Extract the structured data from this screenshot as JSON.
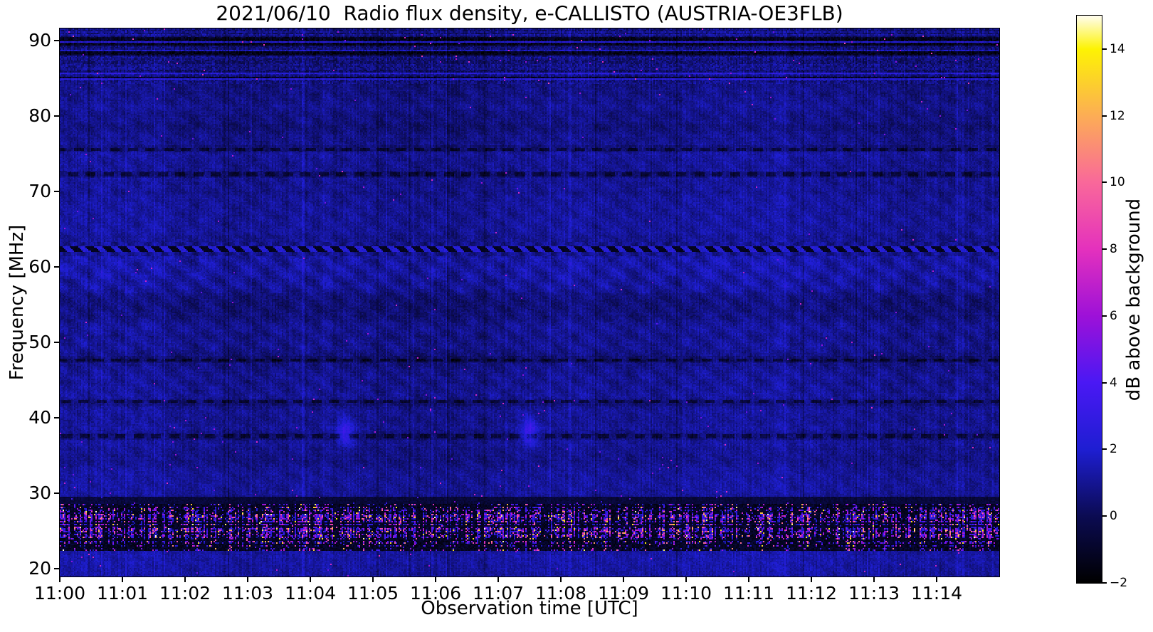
{
  "title": "2021/06/10  Radio flux density, e-CALLISTO (AUSTRIA-OE3FLB)",
  "chart_data": {
    "type": "heatmap",
    "subtype": "radio-spectrogram",
    "title": "2021/06/10  Radio flux density, e-CALLISTO (AUSTRIA-OE3FLB)",
    "xlabel": "Observation time [UTC]",
    "ylabel": "Frequency [MHz]",
    "colorbar_label": "dB above background",
    "x_ticks": [
      "11:00",
      "11:01",
      "11:02",
      "11:03",
      "11:04",
      "11:05",
      "11:06",
      "11:07",
      "11:08",
      "11:09",
      "11:10",
      "11:11",
      "11:12",
      "11:13",
      "11:14"
    ],
    "x_range_minutes": [
      0,
      15
    ],
    "y_ticks": [
      90,
      80,
      70,
      60,
      50,
      40,
      30,
      20
    ],
    "y_range_mhz": [
      19.0,
      91.6
    ],
    "colorbar_tick_values": [
      14,
      12,
      10,
      8,
      6,
      4,
      2,
      0,
      -2
    ],
    "colorbar_tick_labels": [
      "14",
      "12",
      "10",
      "8",
      "6",
      "4",
      "2",
      "0",
      "−2"
    ],
    "colorbar_range": [
      -2,
      15
    ],
    "grid": false,
    "legend": "none",
    "colormap": {
      "name": "gnuplot2-like",
      "stops": [
        [
          -2,
          "#000000"
        ],
        [
          0,
          "#0b0b52"
        ],
        [
          2,
          "#1e1ed2"
        ],
        [
          4,
          "#4a18f4"
        ],
        [
          6,
          "#9d11d8"
        ],
        [
          8,
          "#e431bd"
        ],
        [
          10,
          "#f9689a"
        ],
        [
          12,
          "#fcad55"
        ],
        [
          14,
          "#fdf303"
        ],
        [
          15,
          "#fffdf0"
        ]
      ]
    },
    "seed": 42,
    "bands": [
      {
        "name": "fm-broadcast-noise",
        "f_min": 84.2,
        "f_max": 91.6,
        "model": "striped",
        "speck_p": 0.003
      },
      {
        "name": "vhf-quiet-high",
        "f_min": 63.3,
        "f_max": 84.2,
        "model": "quiet",
        "base": 0.8,
        "ripple": 0.3,
        "dark_lines": [
          75.6,
          72.3
        ],
        "speck_p": 0.0008
      },
      {
        "name": "interference-line-62mhz",
        "f_min": 61.4,
        "f_max": 63.3,
        "model": "jagged",
        "center": 62.4
      },
      {
        "name": "herringbone-60mhz",
        "f_min": 56.5,
        "f_max": 61.4,
        "model": "quiet",
        "base": 1.0,
        "ripple": 0.55,
        "dark_lines": [],
        "speck_p": 0.001
      },
      {
        "name": "vhf-quiet-mid",
        "f_min": 42.6,
        "f_max": 56.5,
        "model": "quiet",
        "base": 0.85,
        "ripple": 0.38,
        "dark_lines": [
          47.7
        ],
        "speck_p": 0.0008
      },
      {
        "name": "vhf-quiet-low",
        "f_min": 29.6,
        "f_max": 42.6,
        "model": "quiet",
        "base": 0.8,
        "ripple": 0.25,
        "dark_lines": [
          42.15,
          37.6
        ],
        "blobs": [
          [
            4.55,
            38.2
          ],
          [
            7.5,
            38.3
          ]
        ],
        "speck_p": 0.002
      },
      {
        "name": "transition-dark",
        "f_min": 28.7,
        "f_max": 29.6,
        "model": "dark"
      },
      {
        "name": "shortwave-rfi-band",
        "f_min": 22.4,
        "f_max": 28.7,
        "model": "rfi",
        "peak_f": 25.9
      },
      {
        "name": "bottom-blue-band",
        "f_min": 19.0,
        "f_max": 22.4,
        "model": "quiet",
        "base": 1.3,
        "ripple": 0.2,
        "dark_lines": [],
        "speck_p": 0.002
      }
    ]
  }
}
